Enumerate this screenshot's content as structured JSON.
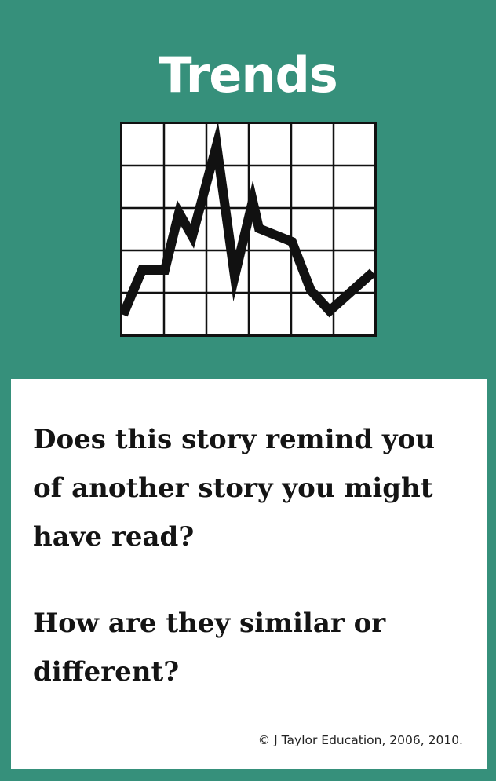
{
  "card": {
    "title": "Trends",
    "background_color": "#36907b",
    "panel_color": "#ffffff"
  },
  "graphic": {
    "icon": "line-chart-icon"
  },
  "questions": [
    "Does this story remind you of another story you might have read?",
    "How are they similar or different?"
  ],
  "footer": {
    "copyright": "© J Taylor Education, 2006, 2010."
  }
}
